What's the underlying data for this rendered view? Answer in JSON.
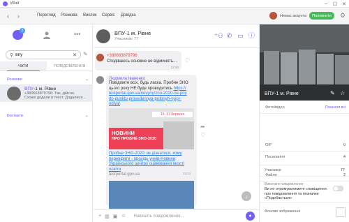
{
  "window": {
    "title": "Viber",
    "controls": [
      "–",
      "☐",
      "✕"
    ]
  },
  "menubar": {
    "items": [
      "Перегляд",
      "Розмова",
      "Виклик",
      "Сервіс",
      "Довідка"
    ],
    "user_name": "Немає акаунта",
    "top_button": "Поповнити"
  },
  "left": {
    "badge": "2",
    "search": {
      "value": "впу",
      "placeholder": "Пошук"
    },
    "tabs": [
      {
        "label": "Чати",
        "active": true
      },
      {
        "label": "Повідомлення",
        "active": false
      }
    ],
    "sections": {
      "chats": "Розмови",
      "contacts": "Контакти"
    },
    "result": {
      "name_highlight": "ВПУ",
      "name_rest": "-1 м. Рівне",
      "msg_line1": "+380663879796: Так, дійсно.",
      "msg_line2": "Схоже додали в текст. Додалися..."
    }
  },
  "chat": {
    "group_name": "ВПУ-1 м. Рівне",
    "group_sub": "Учасників: 77",
    "messages": {
      "phone": "+380663879796",
      "phone_text": "Сподіваюсь основне не відминять...",
      "phone_time": "12:50",
      "sender": "Людмила Іваненко",
      "text_line1": "Повідомте всіх, будь ласка. Пробне ЗНО",
      "text_line2": "цього року НЕ буде проводитись",
      "link1_line1": "https://",
      "link1_line2": "testportal.gov.ua/novyny/zno-2020-ne-priy",
      "link1_line3": "do-punktu-provedennya-probnyh-vyipr-",
      "link1_line4": "odlya/",
      "news_date": "15, 17 березня",
      "news_title1": "НОВИНИ",
      "news_title2": "ПРО ПРОБНЕ ЗНО-2020",
      "link2_line1": "Пробне ЗНО-2020: як дізнатися, кому",
      "link2_line2": "перевіряти - прохідь учнів-Новини",
      "link2_line3": "Українського центру оцінювання якості освіти",
      "domain": "testportal.gov.ua",
      "news_time": "13:01"
    },
    "composer_placeholder": "Напишіть повідомлення..."
  },
  "info": {
    "cover_title": "ВПУ-1 м. Рівне",
    "photos_label": "Фото/відео",
    "photos_link": "Показати всі",
    "rows": [
      {
        "label": "GIF",
        "value": "0"
      },
      {
        "label": "Посилання",
        "value": "4"
      },
      {
        "label": "Файли",
        "value": "2"
      }
    ],
    "members_label": "Учасники",
    "members_count": "77",
    "toggle_title": "Виконати повідомлення",
    "toggle_desc_line1": "Ви не отримуватимете сповіщення",
    "toggle_desc_line2": "про повідомлення та позначки",
    "toggle_desc_line3": "«Подобається»",
    "background_label": "Фонове зображення"
  },
  "colors": {
    "accent": "#7360f2",
    "green": "#49b85a",
    "link": "#2c7be5",
    "news_red": "#ee4056"
  }
}
